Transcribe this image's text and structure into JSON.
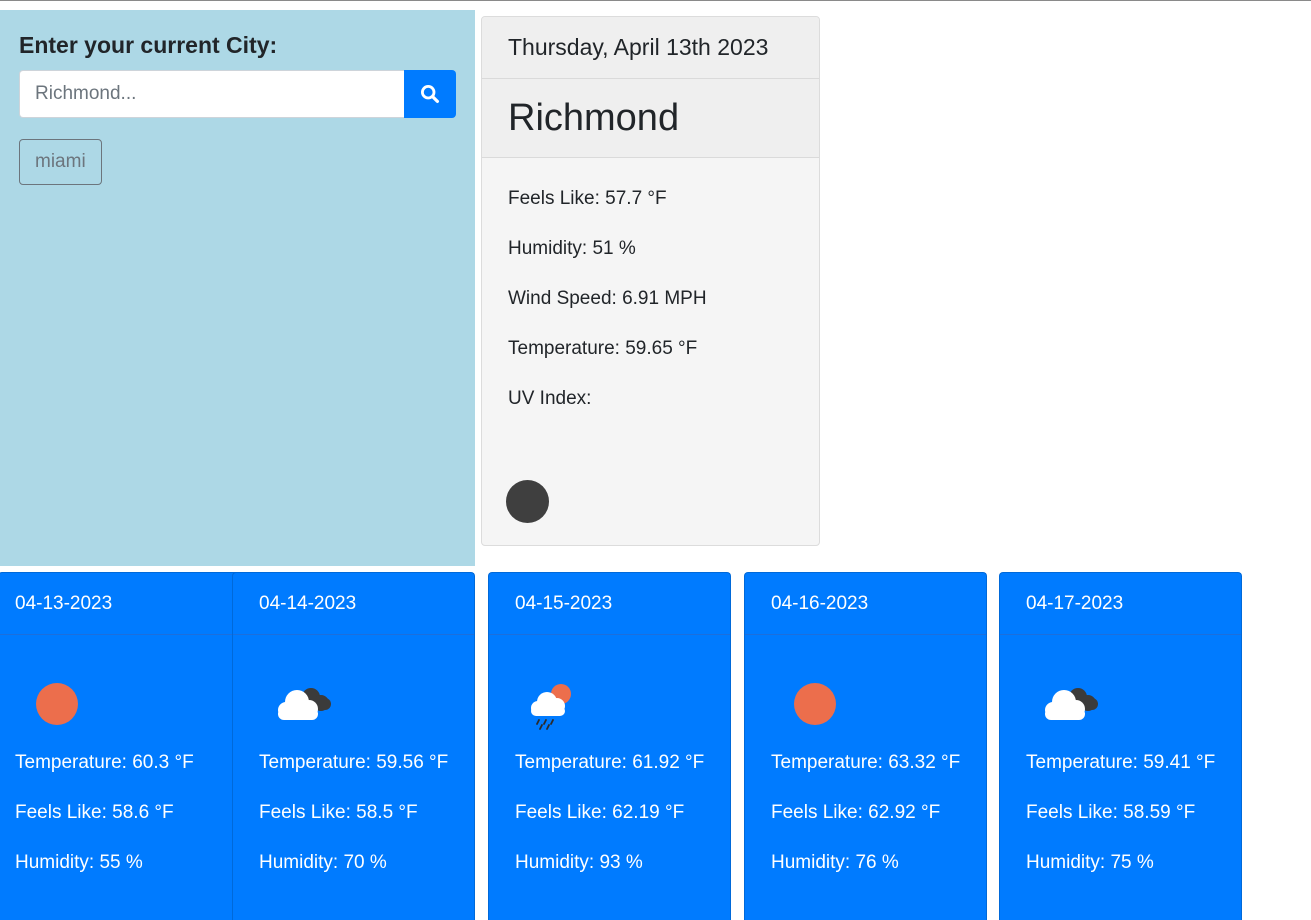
{
  "sidebar": {
    "title": "Enter your current City:",
    "search_placeholder": "Richmond...",
    "search_value": "",
    "search_icon": "search-icon",
    "history": [
      "miami"
    ]
  },
  "current": {
    "date": "Thursday, April 13th 2023",
    "city": "Richmond",
    "feels_like": "Feels Like: 57.7 °F",
    "humidity": "Humidity: 51 %",
    "wind_speed": "Wind Speed: 6.91 MPH",
    "temperature": "Temperature: 59.65 °F",
    "uv_index": "UV Index:",
    "uv_dot_color": "#3f3f3f"
  },
  "colors": {
    "sidebar_bg": "#add8e6",
    "accent": "#007bff",
    "sun": "#ec6e4c"
  },
  "forecast": [
    {
      "date": "04-13-2023",
      "icon": "sun-icon",
      "temp": "Temperature: 60.3 °F",
      "feels": "Feels Like: 58.6 °F",
      "humidity": "Humidity: 55 %"
    },
    {
      "date": "04-14-2023",
      "icon": "broken-clouds-icon",
      "temp": "Temperature: 59.56 °F",
      "feels": "Feels Like: 58.5 °F",
      "humidity": "Humidity: 70 %"
    },
    {
      "date": "04-15-2023",
      "icon": "rain-sun-icon",
      "temp": "Temperature: 61.92 °F",
      "feels": "Feels Like: 62.19 °F",
      "humidity": "Humidity: 93 %"
    },
    {
      "date": "04-16-2023",
      "icon": "sun-icon",
      "temp": "Temperature: 63.32 °F",
      "feels": "Feels Like: 62.92 °F",
      "humidity": "Humidity: 76 %"
    },
    {
      "date": "04-17-2023",
      "icon": "broken-clouds-icon",
      "temp": "Temperature: 59.41 °F",
      "feels": "Feels Like: 58.59 °F",
      "humidity": "Humidity: 75 %"
    }
  ]
}
